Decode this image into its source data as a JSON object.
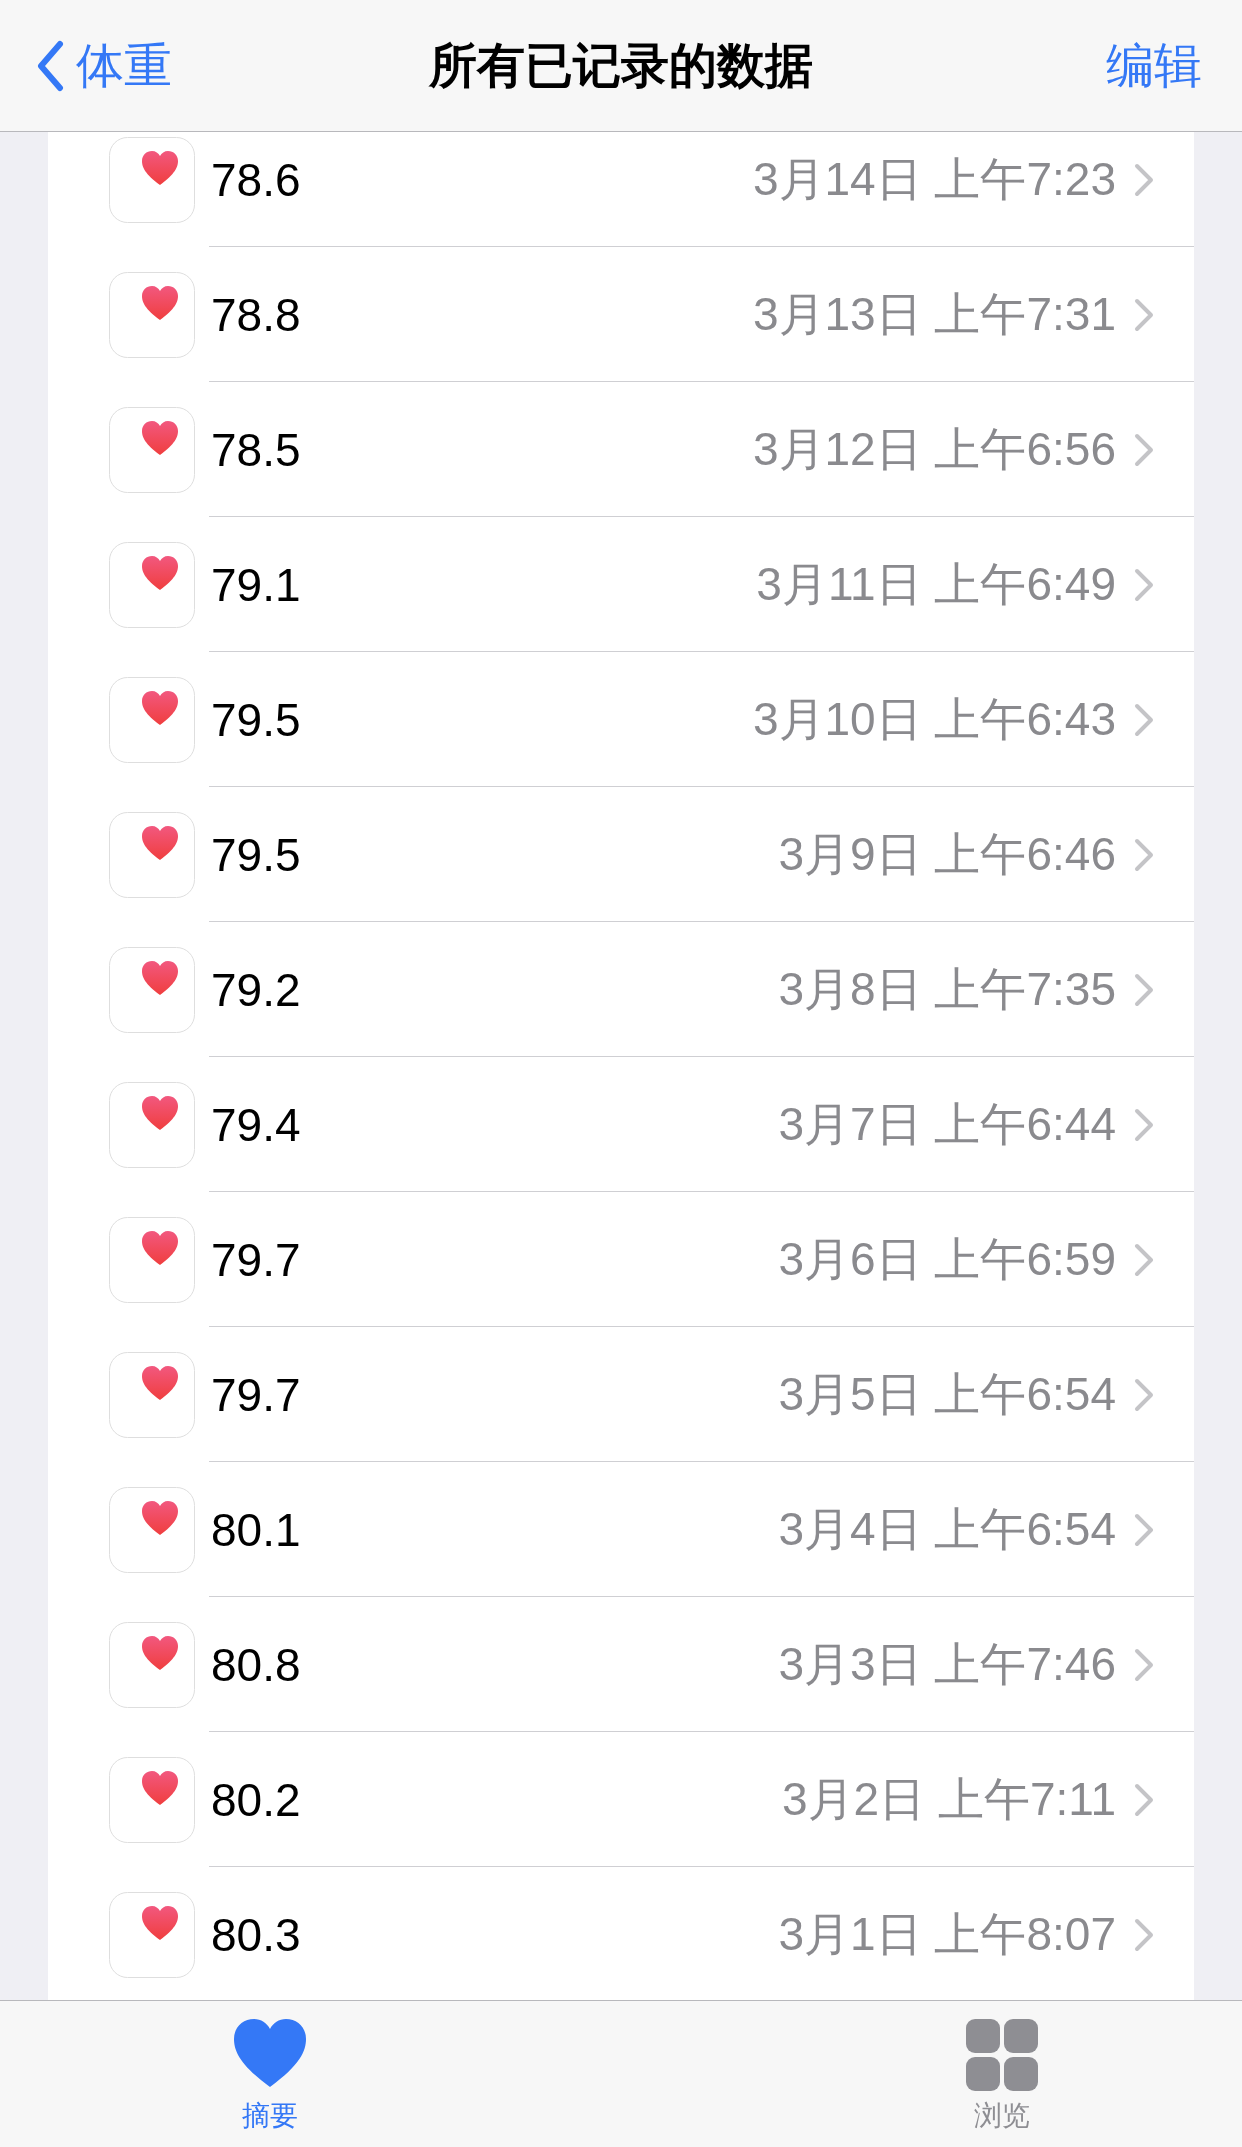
{
  "nav": {
    "back": "体重",
    "title": "所有已记录的数据",
    "action": "编辑"
  },
  "records": [
    {
      "value": "78.6",
      "time": "3月14日 上午7:23"
    },
    {
      "value": "78.8",
      "time": "3月13日 上午7:31"
    },
    {
      "value": "78.5",
      "time": "3月12日 上午6:56"
    },
    {
      "value": "79.1",
      "time": "3月11日 上午6:49"
    },
    {
      "value": "79.5",
      "time": "3月10日 上午6:43"
    },
    {
      "value": "79.5",
      "time": "3月9日 上午6:46"
    },
    {
      "value": "79.2",
      "time": "3月8日 上午7:35"
    },
    {
      "value": "79.4",
      "time": "3月7日 上午6:44"
    },
    {
      "value": "79.7",
      "time": "3月6日 上午6:59"
    },
    {
      "value": "79.7",
      "time": "3月5日 上午6:54"
    },
    {
      "value": "80.1",
      "time": "3月4日 上午6:54"
    },
    {
      "value": "80.8",
      "time": "3月3日 上午7:46"
    },
    {
      "value": "80.2",
      "time": "3月2日 上午7:11"
    },
    {
      "value": "80.3",
      "time": "3月1日 上午8:07"
    }
  ],
  "tab_bar": [
    {
      "kind": "heart",
      "label": "摘要",
      "selected": true
    },
    {
      "kind": "grid",
      "label": "浏览",
      "selected": false
    }
  ]
}
